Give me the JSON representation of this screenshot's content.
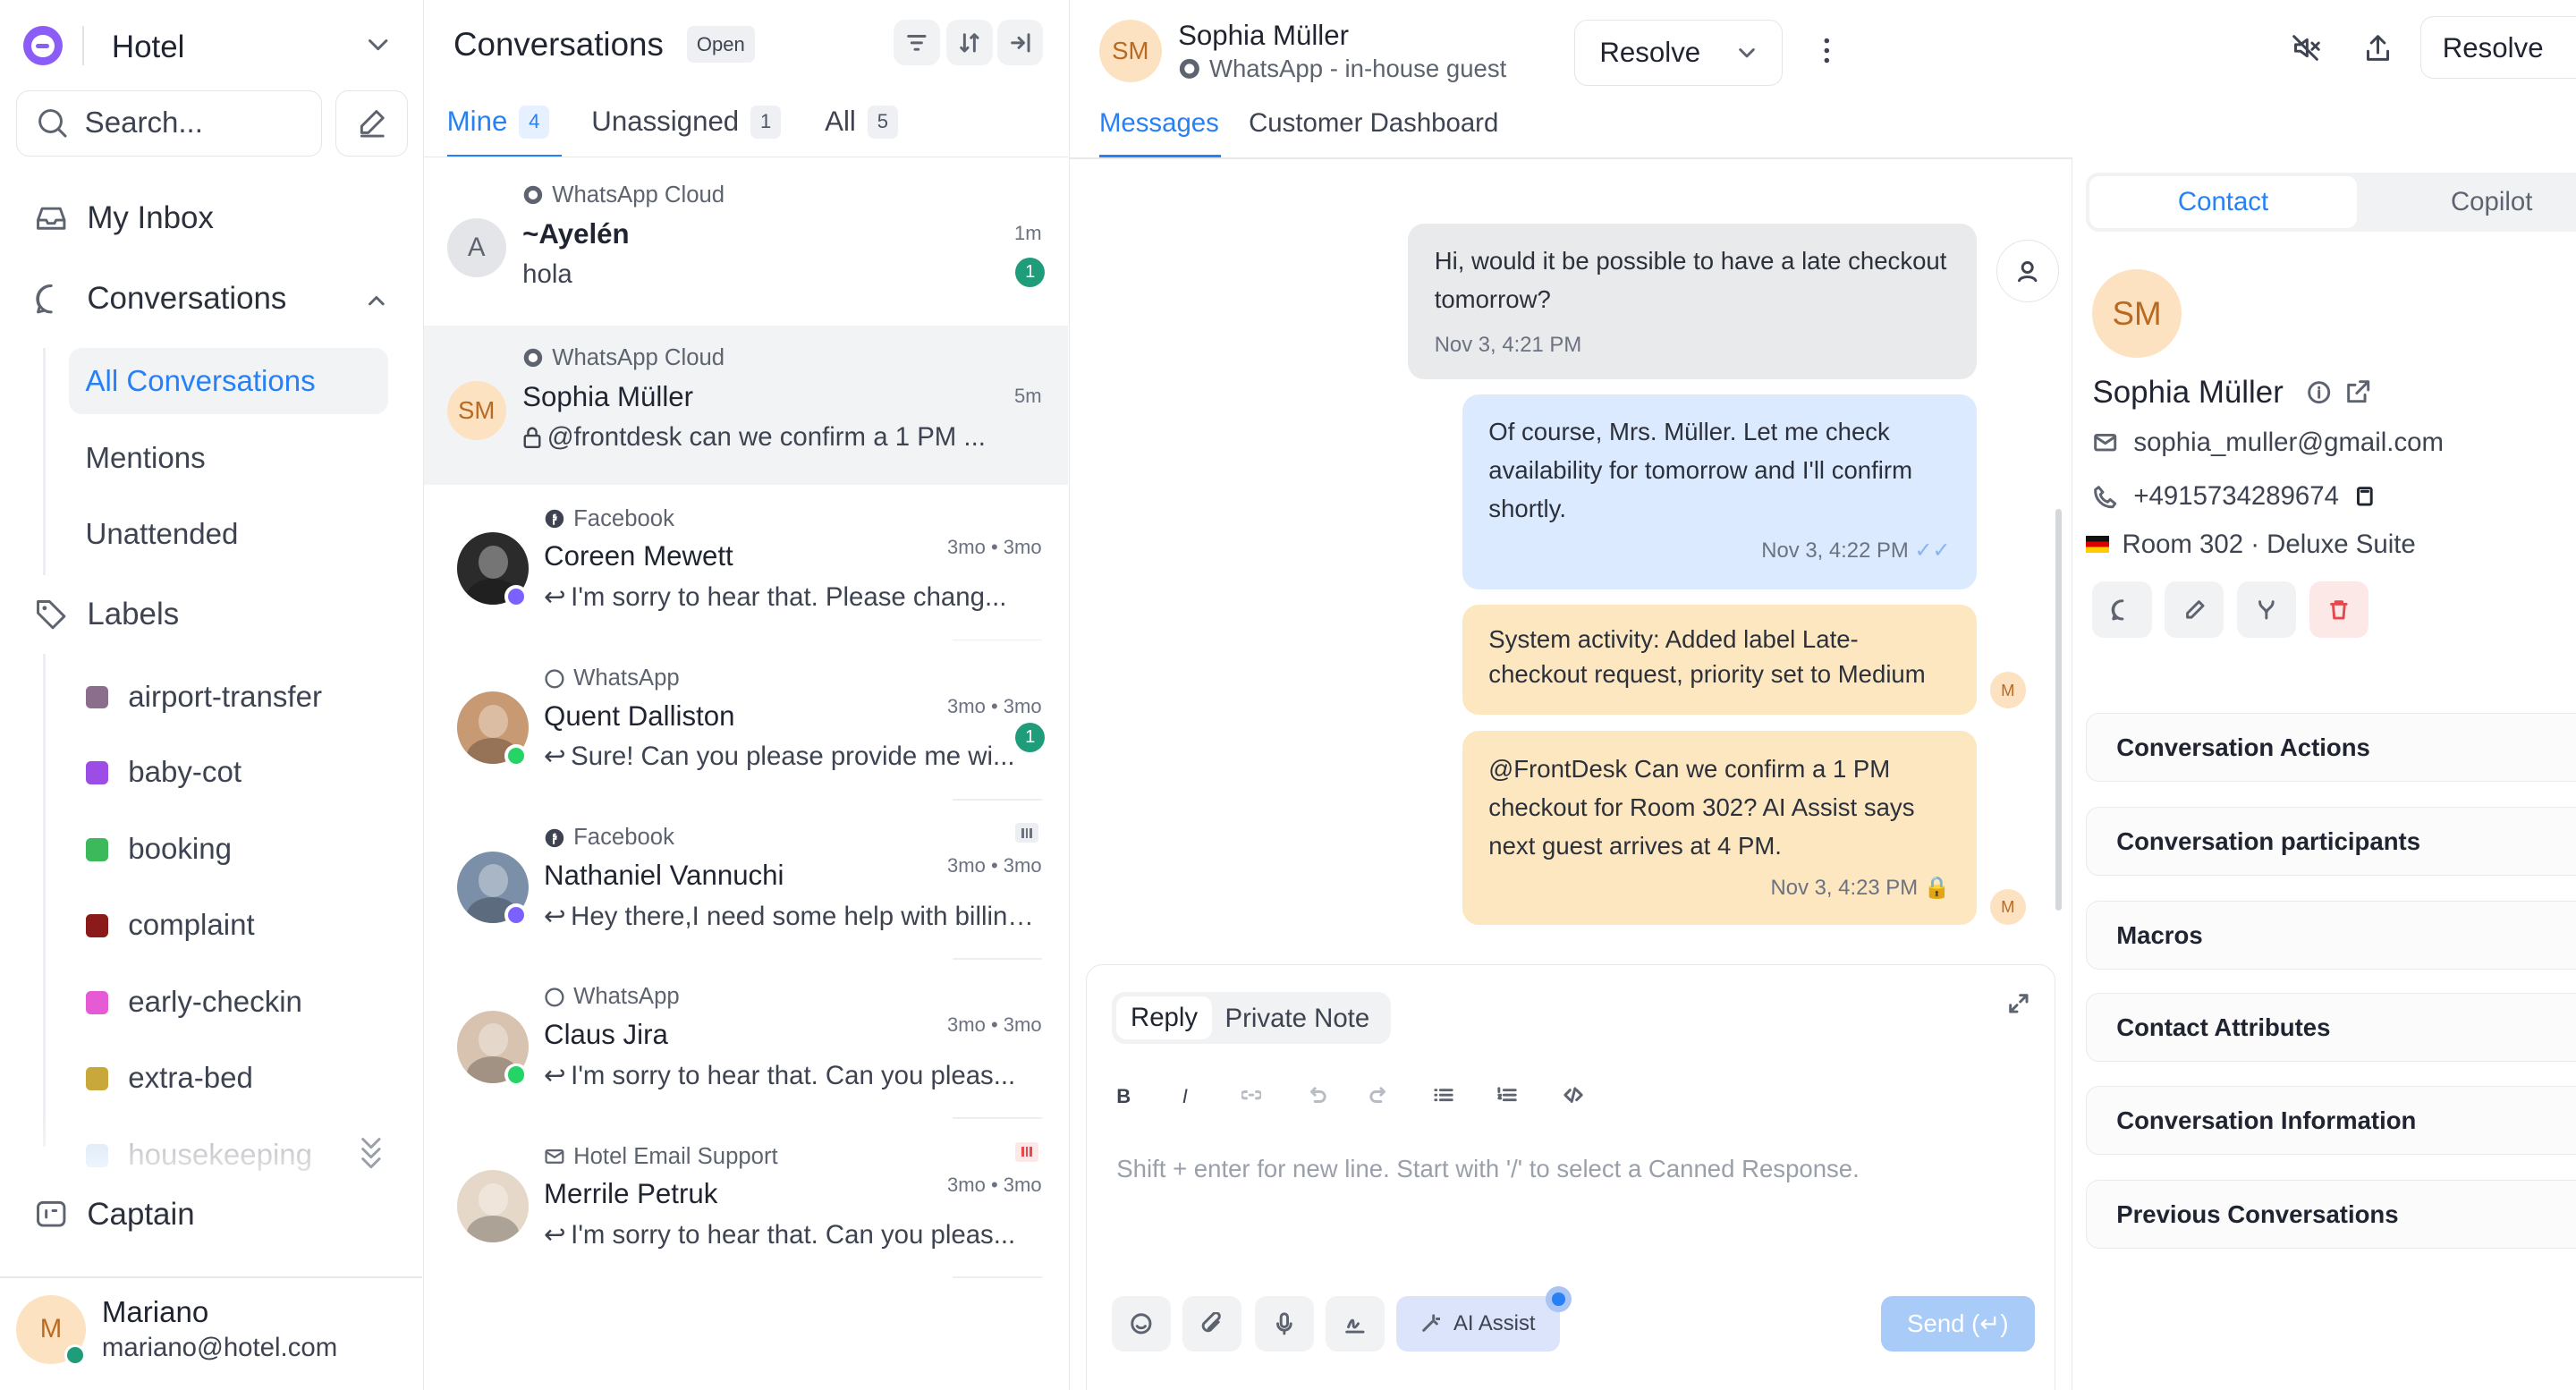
{
  "sidebar": {
    "workspace": "Hotel",
    "search_placeholder": "Search...",
    "my_inbox": "My Inbox",
    "conversations": "Conversations",
    "all_conversations": "All Conversations",
    "mentions": "Mentions",
    "unattended": "Unattended",
    "labels_heading": "Labels",
    "labels": [
      {
        "name": "airport-transfer",
        "color": "#8b6e8c"
      },
      {
        "name": "baby-cot",
        "color": "#9b4de6"
      },
      {
        "name": "booking",
        "color": "#3cb95a"
      },
      {
        "name": "complaint",
        "color": "#8b1a1a"
      },
      {
        "name": "early-checkin",
        "color": "#e65ad6"
      },
      {
        "name": "extra-bed",
        "color": "#c8a83a"
      },
      {
        "name": "housekeeping",
        "color": "#9ec3f0"
      }
    ],
    "captain": "Captain",
    "user": {
      "initial": "M",
      "name": "Mariano",
      "email": "mariano@hotel.com"
    }
  },
  "list": {
    "title": "Conversations",
    "status": "Open",
    "tabs": [
      {
        "label": "Mine",
        "count": "4"
      },
      {
        "label": "Unassigned",
        "count": "1"
      },
      {
        "label": "All",
        "count": "5"
      }
    ],
    "items": [
      {
        "source": "WhatsApp Cloud",
        "name": "~Ayelén",
        "initials": "A",
        "message": "hola",
        "time": "1m",
        "unread": "1"
      },
      {
        "source": "WhatsApp Cloud",
        "name": "Sophia Müller",
        "initials": "SM",
        "message": "@frontdesk can we confirm a 1 PM ...",
        "time": "5m"
      },
      {
        "source": "Facebook",
        "name": "Coreen Mewett",
        "message": "I'm sorry to hear that. Please chang...",
        "time": "3mo • 3mo"
      },
      {
        "source": "WhatsApp",
        "name": "Quent Dalliston",
        "message": "Sure! Can you please provide me wi...",
        "time": "3mo • 3mo",
        "unread": "1"
      },
      {
        "source": "Facebook",
        "name": "Nathaniel Vannuchi",
        "message": "Hey there,I need some help with billing...",
        "time": "3mo • 3mo"
      },
      {
        "source": "WhatsApp",
        "name": "Claus Jira",
        "message": "I'm sorry to hear that. Can you pleas...",
        "time": "3mo • 3mo"
      },
      {
        "source": "Hotel Email Support",
        "name": "Merrile Petruk",
        "message": "I'm sorry to hear that. Can you pleas...",
        "time": "3mo • 3mo"
      }
    ]
  },
  "chat": {
    "contact_initials": "SM",
    "contact_name": "Sophia Müller",
    "contact_sub": "WhatsApp - in-house guest",
    "resolve_button": "Resolve",
    "resolve_top": "Resolve",
    "tab_messages": "Messages",
    "tab_dashboard": "Customer Dashboard",
    "messages": [
      {
        "text": "Hi, would it be possible to have a late checkout tomorrow?",
        "time": "Nov 3, 4:21 PM"
      },
      {
        "text": "Of course, Mrs. Müller. Let me check availability for tomorrow and I'll confirm shortly.",
        "time": "Nov 3, 4:22 PM"
      },
      {
        "text": "System activity: Added label Late-checkout request, priority set to Medium"
      },
      {
        "text": "@FrontDesk Can we confirm a 1 PM checkout for Room 302? AI Assist says next guest arrives at 4 PM.",
        "time": "Nov 3, 4:23 PM"
      }
    ],
    "agent_initial": "M",
    "reply_tab": "Reply",
    "private_tab": "Private Note",
    "editor_placeholder": "Shift + enter for new line. Start with '/' to select a Canned Response.",
    "ai_assist": "AI Assist",
    "send": "Send (↵)"
  },
  "contact": {
    "tab_contact": "Contact",
    "tab_copilot": "Copilot",
    "initials": "SM",
    "name": "Sophia Müller",
    "email": "sophia_muller@gmail.com",
    "phone": "+4915734289674",
    "room": "Room 302 · Deluxe Suite",
    "sections": [
      "Conversation Actions",
      "Conversation participants",
      "Macros",
      "Contact Attributes",
      "Conversation Information",
      "Previous Conversations"
    ]
  },
  "colors": {
    "accent": "#2781f6",
    "unread": "#1f9d7b",
    "note": "#fde7c0",
    "outgoing": "#dbeafe",
    "incoming": "#e9eaec"
  }
}
